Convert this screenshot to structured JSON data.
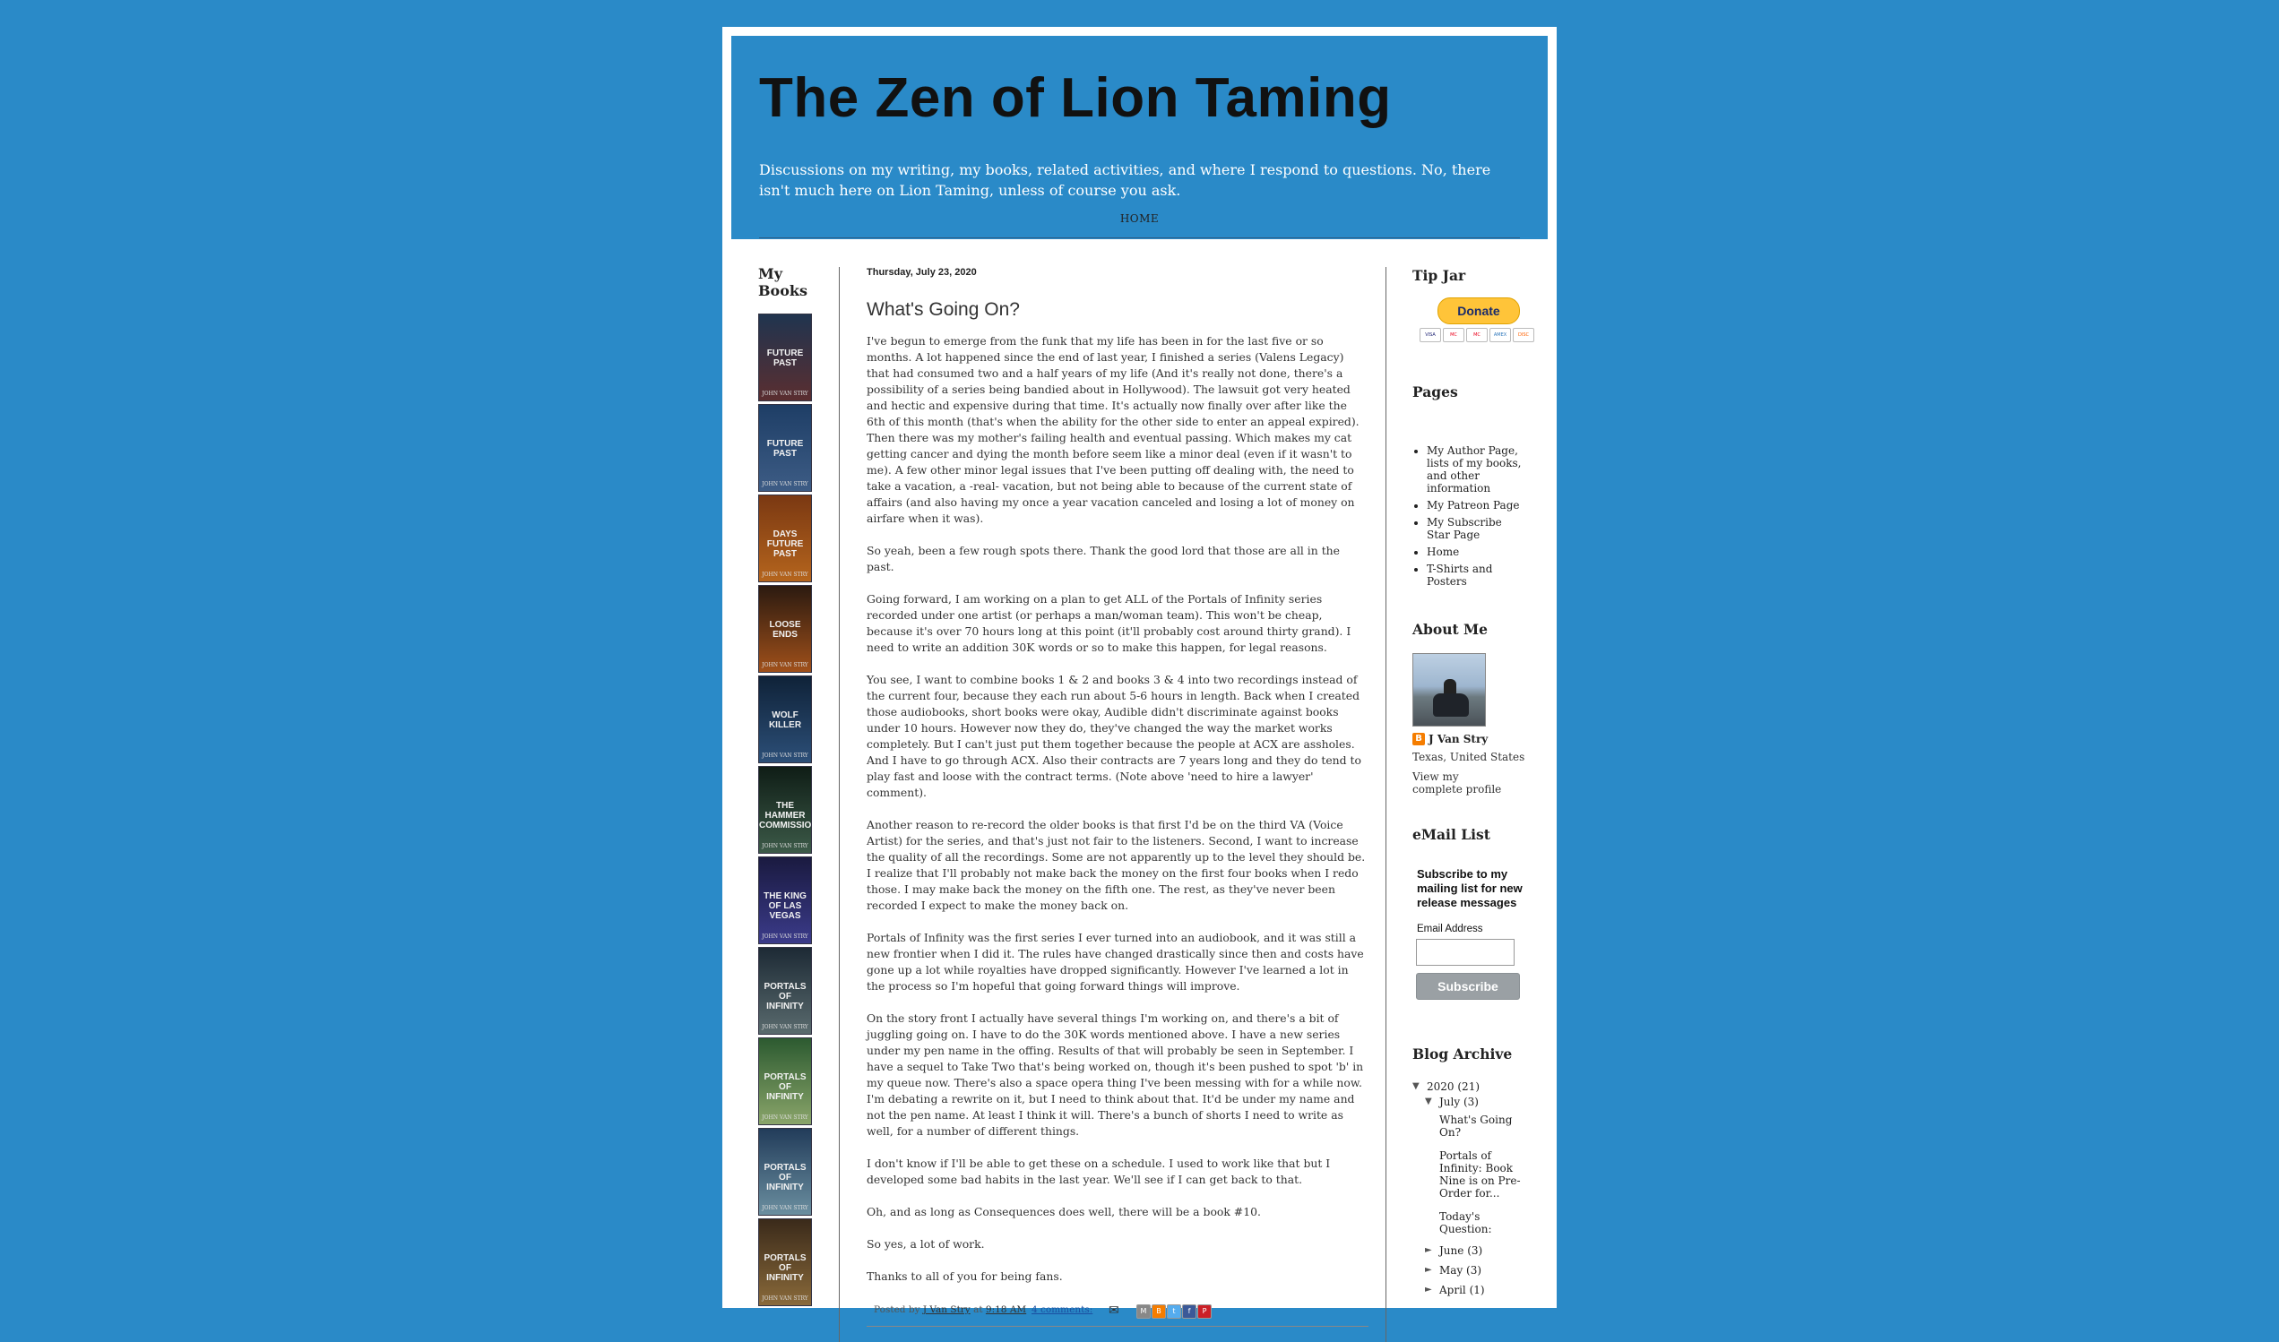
{
  "blog": {
    "title": "The Zen of Lion Taming",
    "description": "Discussions on my writing, my books, related activities, and where I respond to questions. No, there isn't much here on Lion Taming, unless of course you ask.",
    "home_tab": "HOME"
  },
  "left": {
    "title": "My Books",
    "books": [
      {
        "title": "FUTURE PAST",
        "colors": [
          "#20344f",
          "#5a2e30"
        ]
      },
      {
        "title": "FUTURE PAST",
        "colors": [
          "#1e3e66",
          "#3d5c85"
        ]
      },
      {
        "title": "DAYS FUTURE PAST",
        "colors": [
          "#7a3812",
          "#b5651d"
        ]
      },
      {
        "title": "LOOSE ENDS",
        "colors": [
          "#2b1a10",
          "#a0501a"
        ]
      },
      {
        "title": "WOLF KILLER",
        "colors": [
          "#0f2238",
          "#2c4f78"
        ]
      },
      {
        "title": "THE HAMMER COMMISSION",
        "colors": [
          "#0f1d16",
          "#3c5a48"
        ]
      },
      {
        "title": "THE KING OF LAS VEGAS",
        "colors": [
          "#1a1a40",
          "#3b3b8a"
        ]
      },
      {
        "title": "PORTALS OF INFINITY",
        "colors": [
          "#1d2a35",
          "#5a6b6e"
        ]
      },
      {
        "title": "PORTALS OF INFINITY",
        "colors": [
          "#2c5a30",
          "#8aa56a"
        ]
      },
      {
        "title": "PORTALS OF INFINITY",
        "colors": [
          "#223c5a",
          "#6b8fa0"
        ]
      },
      {
        "title": "PORTALS OF INFINITY",
        "colors": [
          "#3a2a1a",
          "#8a6a3a"
        ]
      }
    ],
    "book_author": "JOHN VAN STRY"
  },
  "post": {
    "date": "Thursday, July 23, 2020",
    "title": "What's Going On?",
    "paragraphs": [
      "I've begun to emerge from the funk that my life has been in for the last five or so months. A lot happened since the end of last year, I finished a series (Valens Legacy) that had consumed two and a half years of my life (And it's really not done, there's a possibility of a series being bandied about in Hollywood). The lawsuit got very heated and hectic and expensive during that time. It's actually now finally over after like the 6th of this month (that's when the ability for the other side to enter an appeal expired).",
      "Then there was my mother's failing health and eventual passing. Which makes my cat getting cancer and dying the month before seem like a minor deal (even if it wasn't to me). A few other minor legal issues that I've been putting off dealing with, the need to take a vacation, a -real- vacation, but not being able to because of the current state of affairs (and also having my once a year vacation canceled and losing a lot of money on airfare when it was).",
      "So yeah, been a few rough spots there. Thank the good lord that those are all in the past.",
      "Going forward, I am working on a plan to get ALL of the Portals of Infinity series recorded under one artist (or perhaps a man/woman team). This won't be cheap, because it's over 70 hours long at this point (it'll probably cost around thirty grand). I need to write an addition 30K words or so to make this happen, for legal reasons.",
      "You see, I want to combine books 1 & 2 and books 3 & 4 into two recordings instead of the current four, because they each run about 5-6 hours in length. Back when I created those audiobooks, short books were okay, Audible didn't discriminate against books under 10 hours. However now they do, they've changed the way the market works completely. But I can't just put them together because the people at ACX are assholes. And I have to go through ACX. Also their contracts are 7 years long and they do tend to play fast and loose with the contract terms. (Note above 'need to hire a lawyer' comment).",
      "Another reason to re-record the older books is that first I'd be on the third VA (Voice Artist) for the series, and that's just not fair to the listeners. Second, I want to increase the quality of all the recordings. Some are not apparently up to the level they should be. I realize that I'll probably not make back the money on the first four books when I redo those. I may make back the money on the fifth one. The rest, as they've never been recorded I expect to make the money back on.",
      "Portals of Infinity was the first series I ever turned into an audiobook, and it was still a new frontier when I did it. The rules have changed drastically since then and costs have gone up a lot while royalties have dropped significantly. However I've learned a lot in the process so I'm hopeful that going forward things will improve.",
      "On the story front I actually have several things I'm working on, and there's a bit of juggling going on. I have to do the 30K words mentioned above. I have a new series under my pen name in the offing. Results of that will probably be seen in September. I have a sequel to Take Two that's being worked on, though it's been pushed to spot 'b' in my queue now. There's also a space opera thing I've been messing with for a while now. I'm debating a rewrite on it, but I need to think about that. It'd be under my name and not the pen name. At least I think it will. There's a bunch of shorts I need to write as well, for a number of different things.",
      "I don't know if I'll be able to get these on a schedule. I used to work like that but I developed some bad habits in the last year. We'll see if I can get back to that.",
      "Oh, and as long as Consequences does well, there will be a book #10.",
      "So yes, a lot of work.",
      "Thanks to all of you for being fans."
    ],
    "footer": {
      "posted_by_label": "Posted by",
      "author": "J Van Stry",
      "at_label": "at",
      "time": "9:18 AM",
      "comments": "4 comments:"
    },
    "share_buttons": [
      "M",
      "B",
      "t",
      "f",
      "P"
    ]
  },
  "right": {
    "tip_jar_title": "Tip Jar",
    "donate_label": "Donate",
    "cards": [
      "VISA",
      "MC",
      "MC",
      "AMEX",
      "DISC"
    ],
    "pages_title": "Pages",
    "pages": [
      "My Author Page, lists of my books, and other information",
      "My Patreon Page",
      "My Subscribe Star Page",
      "Home",
      "T-Shirts and Posters"
    ],
    "about_title": "About Me",
    "profile_name": "J Van Stry",
    "profile_location": "Texas, United States",
    "profile_link": "View my complete profile",
    "email_list_title": "eMail List",
    "subscribe_heading": "Subscribe to my mailing list for new release messages",
    "email_label": "Email Address",
    "email_value": "",
    "subscribe_button": "Subscribe",
    "archive_title": "Blog Archive",
    "archive": {
      "year": "2020",
      "year_count": "(21)",
      "month": "July",
      "month_count": "(3)",
      "posts": [
        "What's Going On?",
        "Portals of Infinity: Book Nine is on Pre-Order for...",
        "Today's Question:"
      ],
      "other_months": [
        {
          "month": "June",
          "count": "(3)"
        },
        {
          "month": "May",
          "count": "(3)"
        },
        {
          "month": "April",
          "count": "(1)"
        }
      ]
    }
  }
}
